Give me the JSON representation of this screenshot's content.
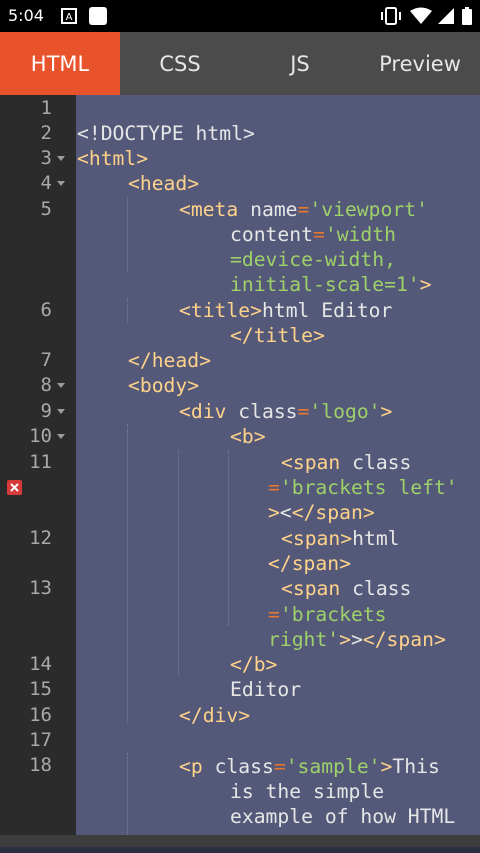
{
  "status_bar": {
    "time": "5:04",
    "notification_icons": [
      "a-box-icon",
      "white-square-icon"
    ],
    "right_icons": [
      "vibrate-icon",
      "wifi-icon",
      "signal-icon",
      "battery-icon"
    ]
  },
  "tabs": [
    {
      "label": "HTML",
      "active": true
    },
    {
      "label": "CSS",
      "active": false
    },
    {
      "label": "JS",
      "active": false
    },
    {
      "label": "Preview",
      "active": false
    }
  ],
  "colors": {
    "active_tab": "#e8532b",
    "tab_bar": "#4b4b4b",
    "editor_bg": "#54597a",
    "gutter_bg": "#2b2b2b",
    "tag": "#ffd28a",
    "attr_value": "#9ed16a",
    "equals": "#e8772e",
    "error_marker": "#d63a3a"
  },
  "editor": {
    "line_numbers": [
      "1",
      "2",
      "3",
      "4",
      "5",
      "6",
      "7",
      "8",
      "9",
      "10",
      "11",
      "12",
      "13",
      "14",
      "15",
      "16",
      "17",
      "18"
    ],
    "fold_markers_on_lines": [
      "3",
      "4",
      "8",
      "9",
      "10"
    ],
    "error_marker_icon": "error-x-icon",
    "code": {
      "l2": "<!DOCTYPE html>",
      "l3": "<html>",
      "l4": "<head>",
      "l5a_tag": "<meta",
      "l5a_attr": " name",
      "l5a_eq": "=",
      "l5a_val": "'viewport'",
      "l5b_attr": "content",
      "l5b_eq": "=",
      "l5b_val": "'width",
      "l5c_val": "=device-width,",
      "l5d_val": "initial-scale=1'",
      "l5d_tag": ">",
      "l6a_tag": "<title>",
      "l6a_text": "html Editor",
      "l6b_tag": "</title>",
      "l7": "</head>",
      "l8": "<body>",
      "l9_tag": "<div",
      "l9_attr": " class",
      "l9_eq": "=",
      "l9_val": "'logo'",
      "l9_end": ">",
      "l10": "<b>",
      "l11a_tag": "<span",
      "l11a_attr": " class",
      "l11b_eq": "=",
      "l11b_val": "'brackets left'",
      "l11c_tag": ">",
      "l11c_text": "<",
      "l11c_end": "</span>",
      "l12a_tag": "<span>",
      "l12a_text": "html",
      "l12b_tag": "</span>",
      "l13a_tag": "<span",
      "l13a_attr": " class",
      "l13b_eq": "=",
      "l13b_val": "'brackets",
      "l13c_val": "right'",
      "l13c_tag": ">",
      "l13c_text": ">",
      "l13c_end": "</span>",
      "l14": "</b>",
      "l15": "Editor",
      "l16": "</div>",
      "l18a_tag": "<p",
      "l18a_attr": " class",
      "l18a_eq": "=",
      "l18a_val": "'sample'",
      "l18a_end": ">",
      "l18a_text": "This",
      "l18b_text": "is the simple",
      "l18c_text": "example of how HTML"
    }
  }
}
